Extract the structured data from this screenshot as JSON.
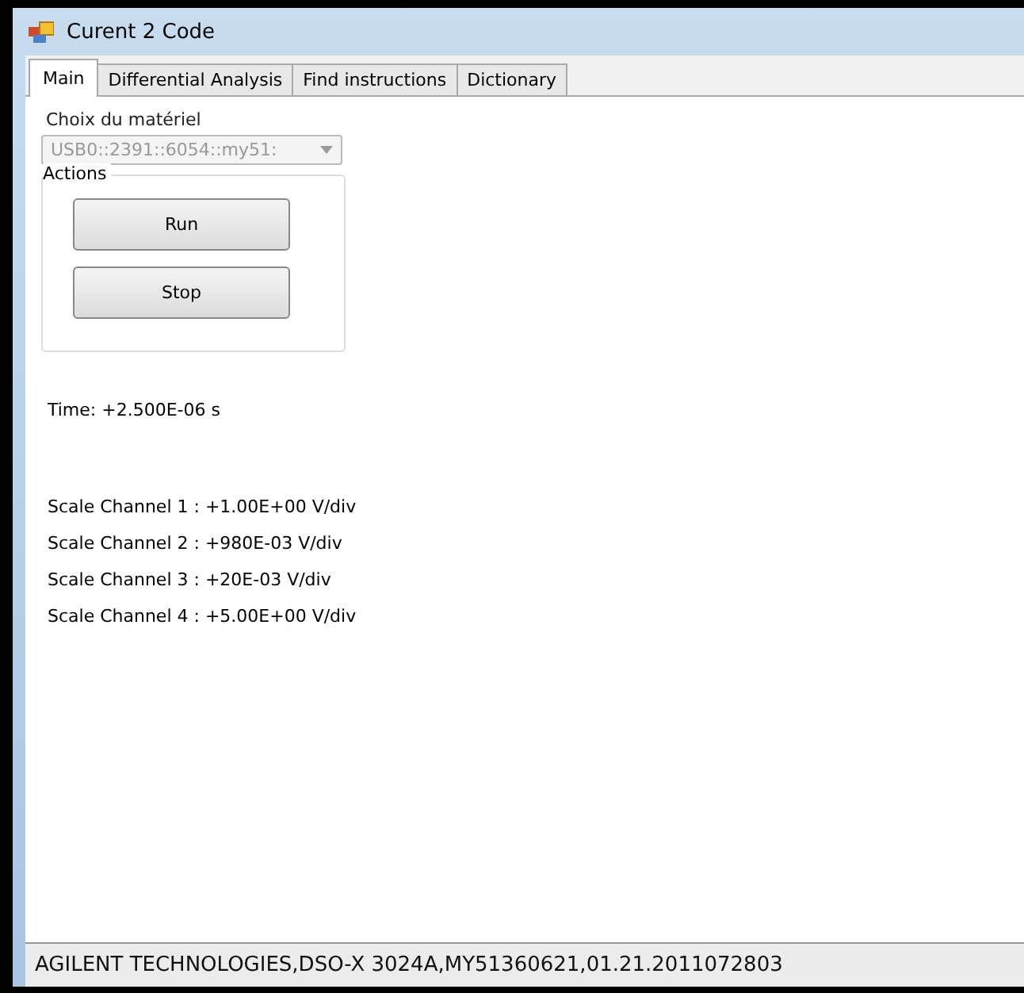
{
  "window": {
    "title": "Curent 2 Code"
  },
  "tabs": [
    {
      "label": "Main",
      "selected": true
    },
    {
      "label": "Differential Analysis",
      "selected": false
    },
    {
      "label": "Find instructions",
      "selected": false
    },
    {
      "label": "Dictionary",
      "selected": false
    }
  ],
  "device": {
    "label": "Choix du matériel",
    "value": "USB0::2391::6054::my51:",
    "disabled": true
  },
  "actions": {
    "title": "Actions",
    "buttons": [
      "Run",
      "Stop"
    ]
  },
  "time": "Time: +2.500E-06 s",
  "scales": [
    "Scale Channel 1 : +1.00E+00 V/div",
    "Scale Channel 2 : +980E-03 V/div",
    "Scale Channel 3 : +20E-03 V/div",
    "Scale Channel 4 : +5.00E+00 V/div"
  ],
  "status_bar": "AGILENT TECHNOLOGIES,DSO-X 3024A,MY51360621,01.21.2011072803"
}
